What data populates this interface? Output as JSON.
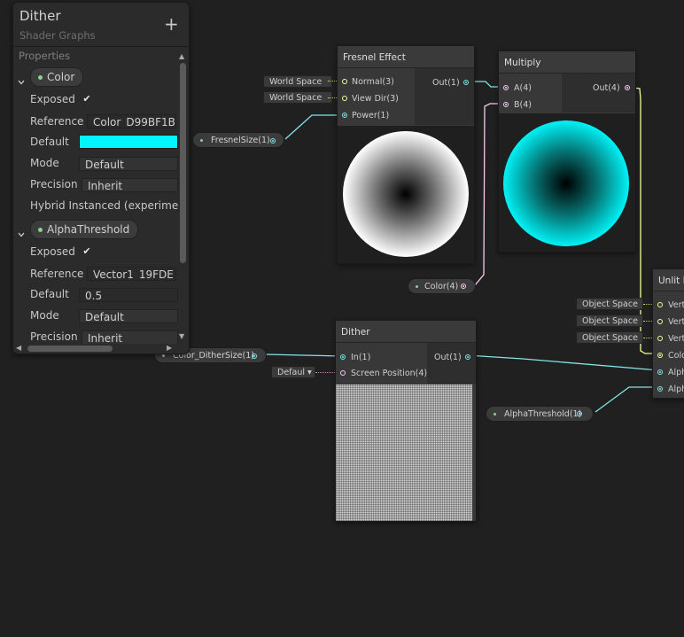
{
  "blackboard": {
    "title": "Dither",
    "subtitle": "Shader Graphs",
    "add_label": "+",
    "section_label": "Properties",
    "properties": [
      {
        "name": "Color",
        "rows": {
          "exposed_label": "Exposed",
          "exposed_check": "✔",
          "reference_label": "Reference",
          "reference_value": "Color_D99BF1B",
          "default_label": "Default",
          "default_color": "#00f6ff",
          "mode_label": "Mode",
          "mode_value": "Default",
          "precision_label": "Precision",
          "precision_value": "Inherit",
          "hybrid_label": "Hybrid Instanced (experimer"
        }
      },
      {
        "name": "AlphaThreshold",
        "rows": {
          "exposed_label": "Exposed",
          "exposed_check": "✔",
          "reference_label": "Reference",
          "reference_value": "Vector1_19FDE",
          "default_label": "Default",
          "default_value": "0.5",
          "mode_label": "Mode",
          "mode_value": "Default",
          "precision_label": "Precision",
          "precision_value": "Inherit"
        }
      }
    ],
    "scroll_up": "▲",
    "scroll_down": "▼",
    "scroll_left": "◀",
    "scroll_right": "▶"
  },
  "nodes": {
    "fresnel": {
      "title": "Fresnel Effect",
      "inputs": [
        "Normal(3)",
        "View Dir(3)",
        "Power(1)"
      ],
      "output": "Out(1)",
      "input_chips": [
        "World Space",
        "World Space"
      ]
    },
    "multiply": {
      "title": "Multiply",
      "inputs": [
        "A(4)",
        "B(4)"
      ],
      "output": "Out(4)"
    },
    "dither": {
      "title": "Dither",
      "inputs": [
        "In(1)",
        "Screen Position(4)"
      ],
      "output": "Out(1)",
      "dropdown_label": "Defaul",
      "dropdown_arrow": "▾"
    },
    "unlit": {
      "title": "Unlit M",
      "inputs": [
        "Vert",
        "Vert",
        "Vert",
        "Colo",
        "Alph",
        "Alph"
      ],
      "input_chips": [
        "Object Space",
        "Object Space",
        "Object Space"
      ]
    }
  },
  "property_nodes": {
    "fresnel_size": "FresnelSize(1)",
    "color": "Color(4)",
    "color_dither_size": "Color_DitherSize(1)",
    "alpha_threshold": "AlphaThreshold(1)"
  },
  "colors": {
    "float_port": "#84e4e7",
    "vector4_port": "#fbcbf4",
    "vector3_port": "#f6ff9a",
    "property_dot": "#8fd18f"
  }
}
